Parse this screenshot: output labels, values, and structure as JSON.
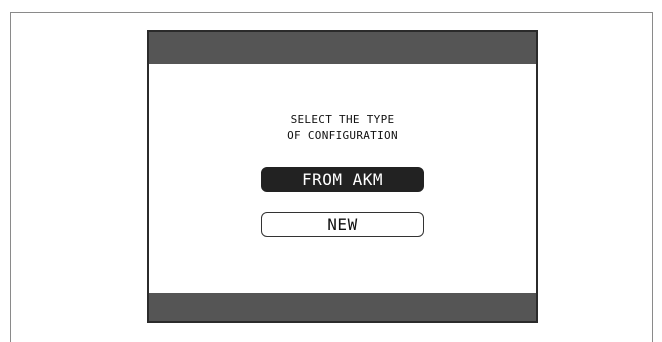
{
  "dialog": {
    "prompt_line1": "SELECT THE TYPE",
    "prompt_line2": "OF CONFIGURATION",
    "options": [
      {
        "label": "FROM AKM",
        "selected": true
      },
      {
        "label": "NEW",
        "selected": false
      }
    ]
  },
  "colors": {
    "bar": "#555555",
    "selected_bg": "#222222",
    "selected_text": "#ffffff"
  }
}
